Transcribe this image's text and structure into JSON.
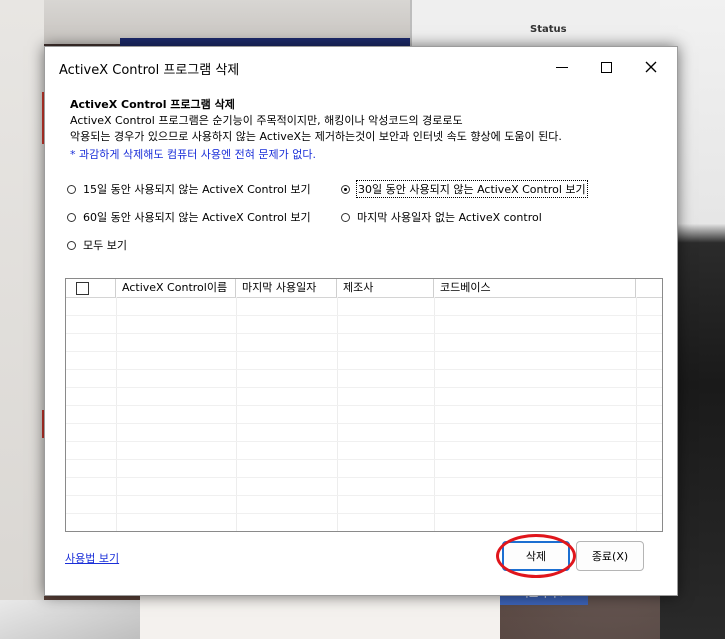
{
  "window": {
    "title": "ActiveX Control 프로그램 삭제"
  },
  "intro": {
    "heading": "ActiveX Control 프로그램 삭제",
    "line1": "ActiveX Control 프로그램은 순기능이 주목적이지만, 해킹이나 악성코드의 경로로도",
    "line2": "악용되는 경우가 있으므로 사용하지 않는 ActiveX는 제거하는것이 보안과 인터넷 속도 향상에 도움이 된다.",
    "note": "* 과감하게 삭제해도 컴퓨터 사용엔 전혀 문제가 없다."
  },
  "filters": {
    "opt_15": "15일 동안 사용되지 않는 ActiveX Control 보기",
    "opt_30": "30일 동안 사용되지 않는 ActiveX Control 보기",
    "opt_60": "60일 동안 사용되지 않는 ActiveX Control 보기",
    "opt_nolast": "마지막 사용일자 없는 ActiveX control",
    "opt_all": "모두 보기",
    "selected": "opt_30"
  },
  "table": {
    "columns": [
      "",
      "ActiveX Control이름",
      "마지막 사용일자",
      "제조사",
      "코드베이스"
    ],
    "rows": []
  },
  "footer": {
    "help_link": "사용법 보기",
    "delete_label": "삭제",
    "exit_label": "종료(X)"
  },
  "background": {
    "status_text": "Status",
    "blue_button": "바로가기 >"
  }
}
